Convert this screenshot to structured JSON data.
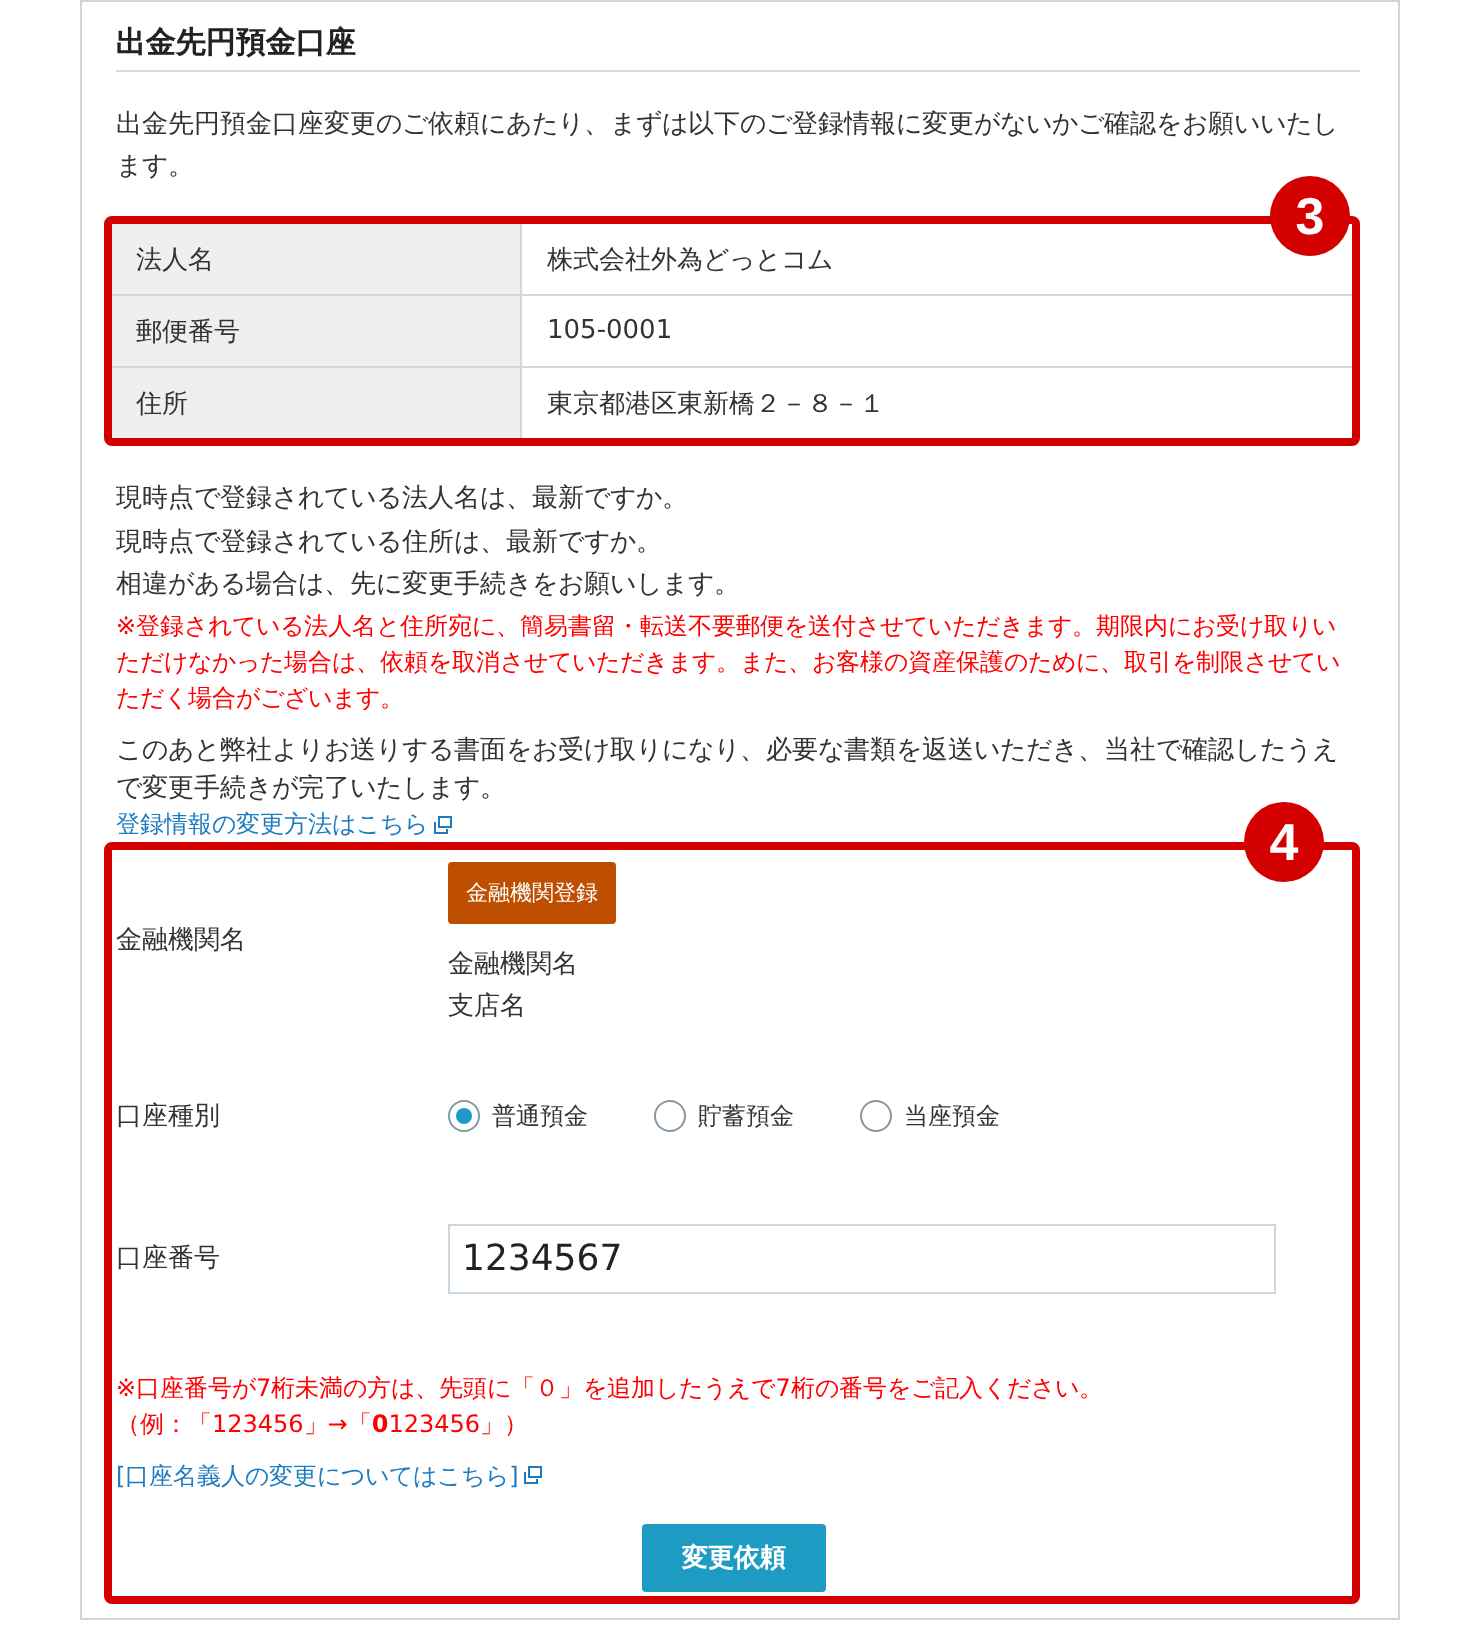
{
  "section": {
    "title": "出金先円預金口座",
    "intro": "出金先円預金口座変更のご依頼にあたり、まずは以下のご登録情報に変更がないかご確認をお願いいたします。"
  },
  "registered_info": {
    "badge": "3",
    "rows": [
      {
        "label": "法人名",
        "value": "株式会社外為どっとコム"
      },
      {
        "label": "郵便番号",
        "value": "105-0001"
      },
      {
        "label": "住所",
        "value": "東京都港区東新橋２－８－１"
      }
    ]
  },
  "confirmation": {
    "questions": [
      "現時点で登録されている法人名は、最新ですか。",
      "現時点で登録されている住所は、最新ですか。",
      "相違がある場合は、先に変更手続きをお願いします。"
    ],
    "notice": "※登録されている法人名と住所宛に、簡易書留・転送不要郵便を送付させていただきます。期限内にお受け取りいただけなかった場合は、依頼を取消させていただきます。また、お客様の資産保護のために、取引を制限させていただく場合がございます。",
    "paragraph": "このあと弊社よりお送りする書面をお受け取りになり、必要な書類を返送いただき、当社で確認したうえで変更手続きが完了いたします。",
    "link": "登録情報の変更方法はこちら"
  },
  "form": {
    "badge": "4",
    "bank": {
      "label": "金融機関名",
      "button": "金融機関登録",
      "bank_name": "金融機関名",
      "branch_name": "支店名"
    },
    "account_type": {
      "label": "口座種別",
      "options": [
        {
          "label": "普通預金",
          "selected": true
        },
        {
          "label": "貯蓄預金",
          "selected": false
        },
        {
          "label": "当座預金",
          "selected": false
        }
      ]
    },
    "account_number": {
      "label": "口座番号",
      "value": "1234567"
    },
    "notice_lines": [
      "※口座番号が7桁未満の方は、先頭に「０」を追加したうえで7桁の番号をご記入ください。",
      "（例：「123456」→「**0**123456」）"
    ],
    "link": "[口座名義人の変更についてはこちら]",
    "submit": "変更依頼"
  }
}
